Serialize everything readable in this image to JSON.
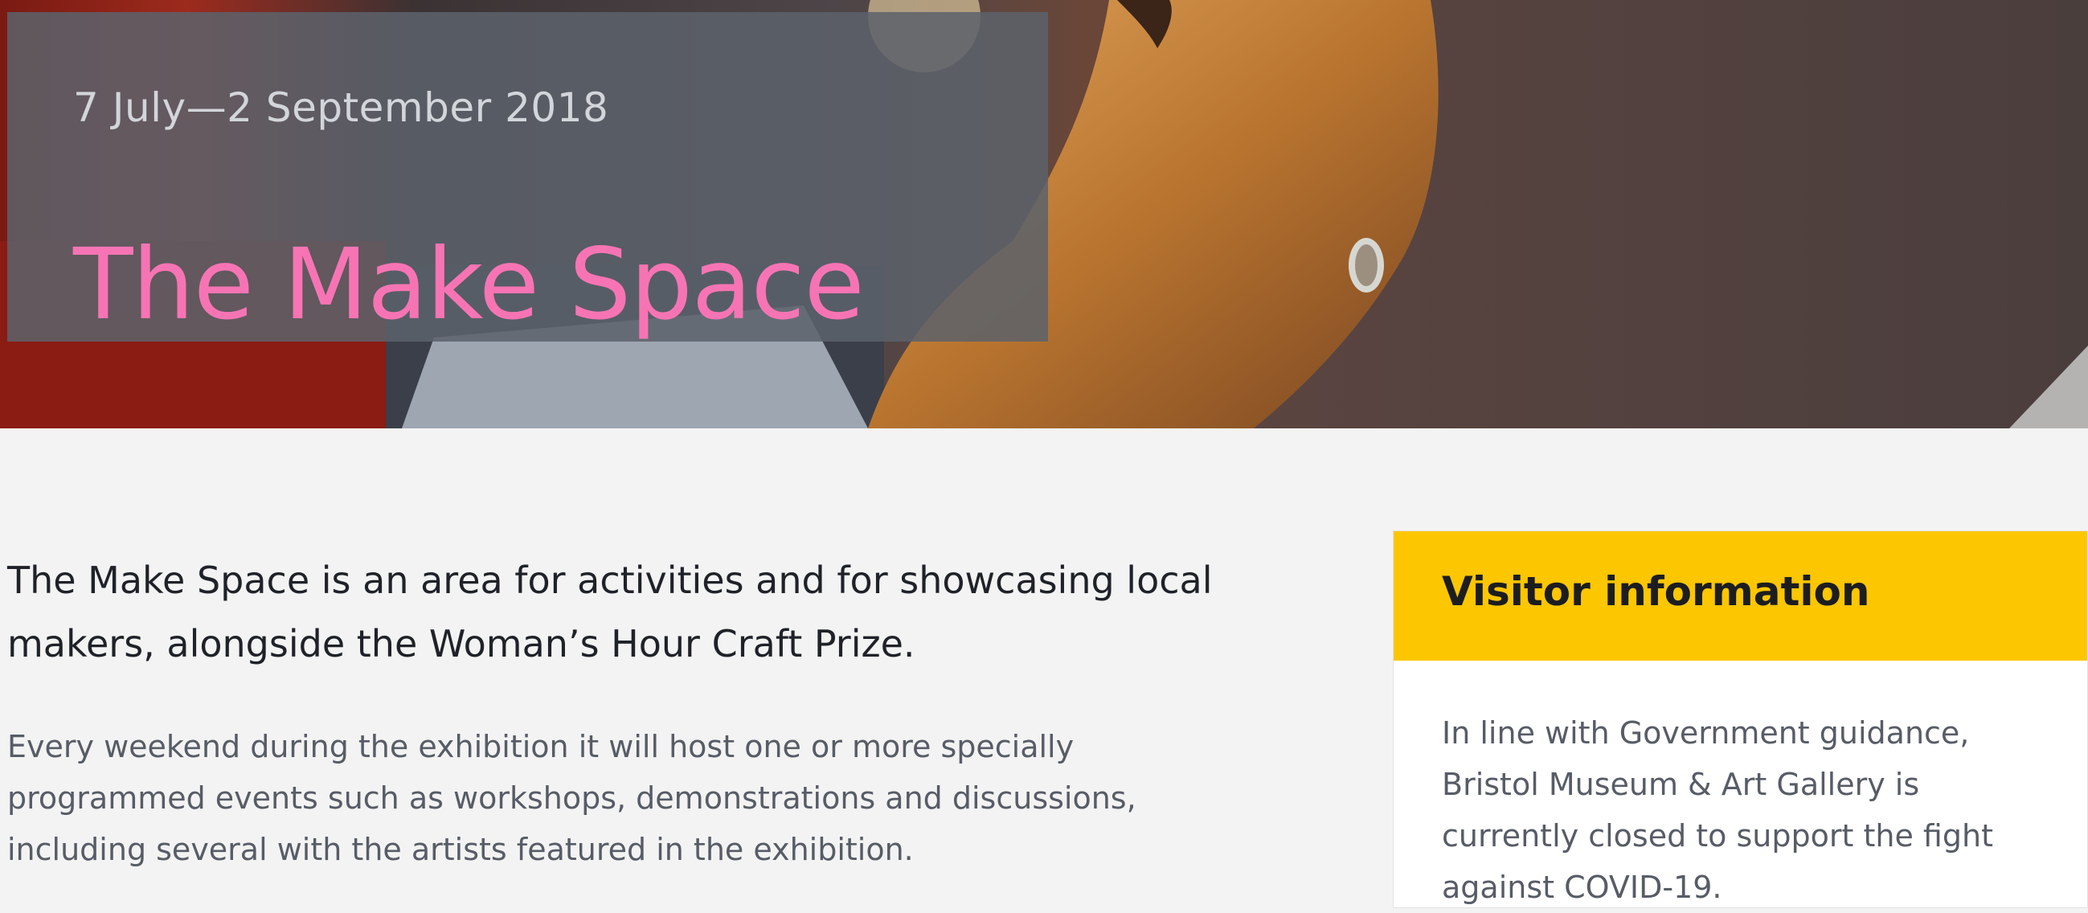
{
  "hero": {
    "date": "7 July—2 September 2018",
    "title": "The Make Space"
  },
  "intro": {
    "lead": "The Make Space is an area for activities and for showcasing local makers, alongside the Woman’s Hour Craft Prize.",
    "body": "Every weekend during the exhibition it will host one or more specially programmed events such as workshops, demonstrations and discussions, including several with the artists featured in the exhibition."
  },
  "visitor_info": {
    "title": "Visitor information",
    "body": "In line with Government guidance, Bristol Museum & Art Gallery is currently closed to support the fight against COVID-19."
  },
  "colors": {
    "title_pink": "#f774b4",
    "visitor_header_yellow": "#fcc600",
    "page_background": "#f3f3f3"
  }
}
